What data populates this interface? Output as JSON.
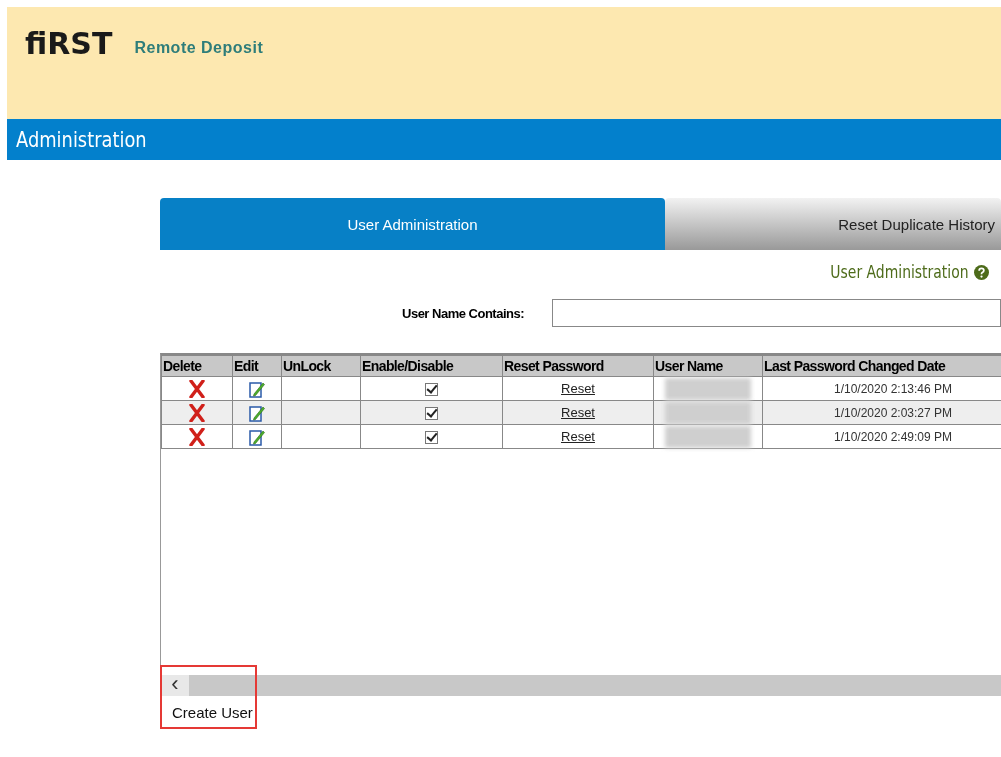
{
  "header": {
    "logo": "fiRST",
    "product": "Remote Deposit"
  },
  "title_bar": {
    "title": "Administration"
  },
  "tabs": [
    {
      "label": "User Administration",
      "selected": true
    },
    {
      "label": "Reset Duplicate History",
      "selected": false
    }
  ],
  "section_title": "User Administration",
  "search": {
    "label": "User Name Contains:"
  },
  "table": {
    "columns": [
      "Delete",
      "Edit",
      "UnLock",
      "Enable/Disable",
      "Reset Password",
      "User Name",
      "Last Password Changed Date"
    ],
    "rows": [
      {
        "enabled": true,
        "reset": "Reset",
        "date": "1/10/2020 2:13:46 PM"
      },
      {
        "enabled": true,
        "reset": "Reset",
        "date": "1/10/2020 2:03:27 PM"
      },
      {
        "enabled": true,
        "reset": "Reset",
        "date": "1/10/2020 2:49:09 PM"
      }
    ]
  },
  "scroll_left": "‹",
  "create_button": "Create User"
}
